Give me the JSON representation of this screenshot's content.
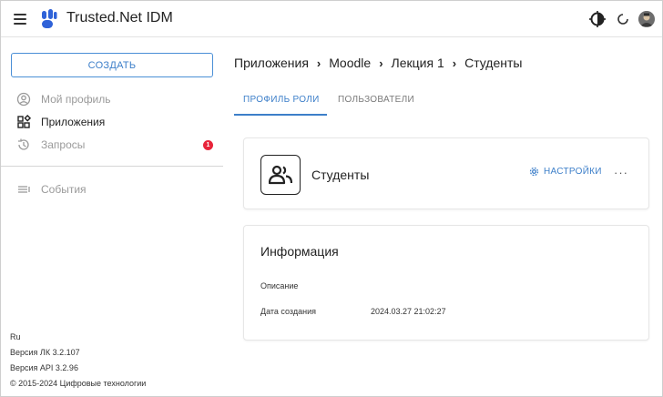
{
  "header": {
    "app_title": "Trusted.Net IDM",
    "icons": [
      "menu-icon",
      "theme-toggle-icon",
      "refresh-icon",
      "user-avatar"
    ]
  },
  "sidebar": {
    "create_label": "СОЗДАТЬ",
    "items": [
      {
        "label": "Мой профиль",
        "icon": "user-circle-icon"
      },
      {
        "label": "Приложения",
        "icon": "apps-grid-icon"
      },
      {
        "label": "Запросы",
        "icon": "history-icon",
        "badge": "1"
      },
      {
        "label": "События",
        "icon": "list-icon"
      }
    ],
    "footer": {
      "language": "Ru",
      "lk_version": "Версия ЛК 3.2.107",
      "api_version": "Версия API 3.2.96",
      "copyright": "© 2015-2024 Цифровые технологии"
    }
  },
  "main": {
    "breadcrumb": [
      "Приложения",
      "Moodle",
      "Лекция 1",
      "Студенты"
    ],
    "tabs": [
      {
        "label": "ПРОФИЛЬ РОЛИ",
        "active": true
      },
      {
        "label": "ПОЛЬЗОВАТЕЛИ",
        "active": false
      }
    ],
    "role_card": {
      "name": "Студенты",
      "settings_label": "НАСТРОЙКИ",
      "more_label": "···"
    },
    "info_card": {
      "title": "Информация",
      "description_label": "Описание",
      "created_label": "Дата создания",
      "created_value": "2024.03.27 21:02:27"
    }
  },
  "colors": {
    "accent": "#3d7fc9",
    "badge": "#e8243a",
    "logo_blue": "#2f62d8"
  }
}
